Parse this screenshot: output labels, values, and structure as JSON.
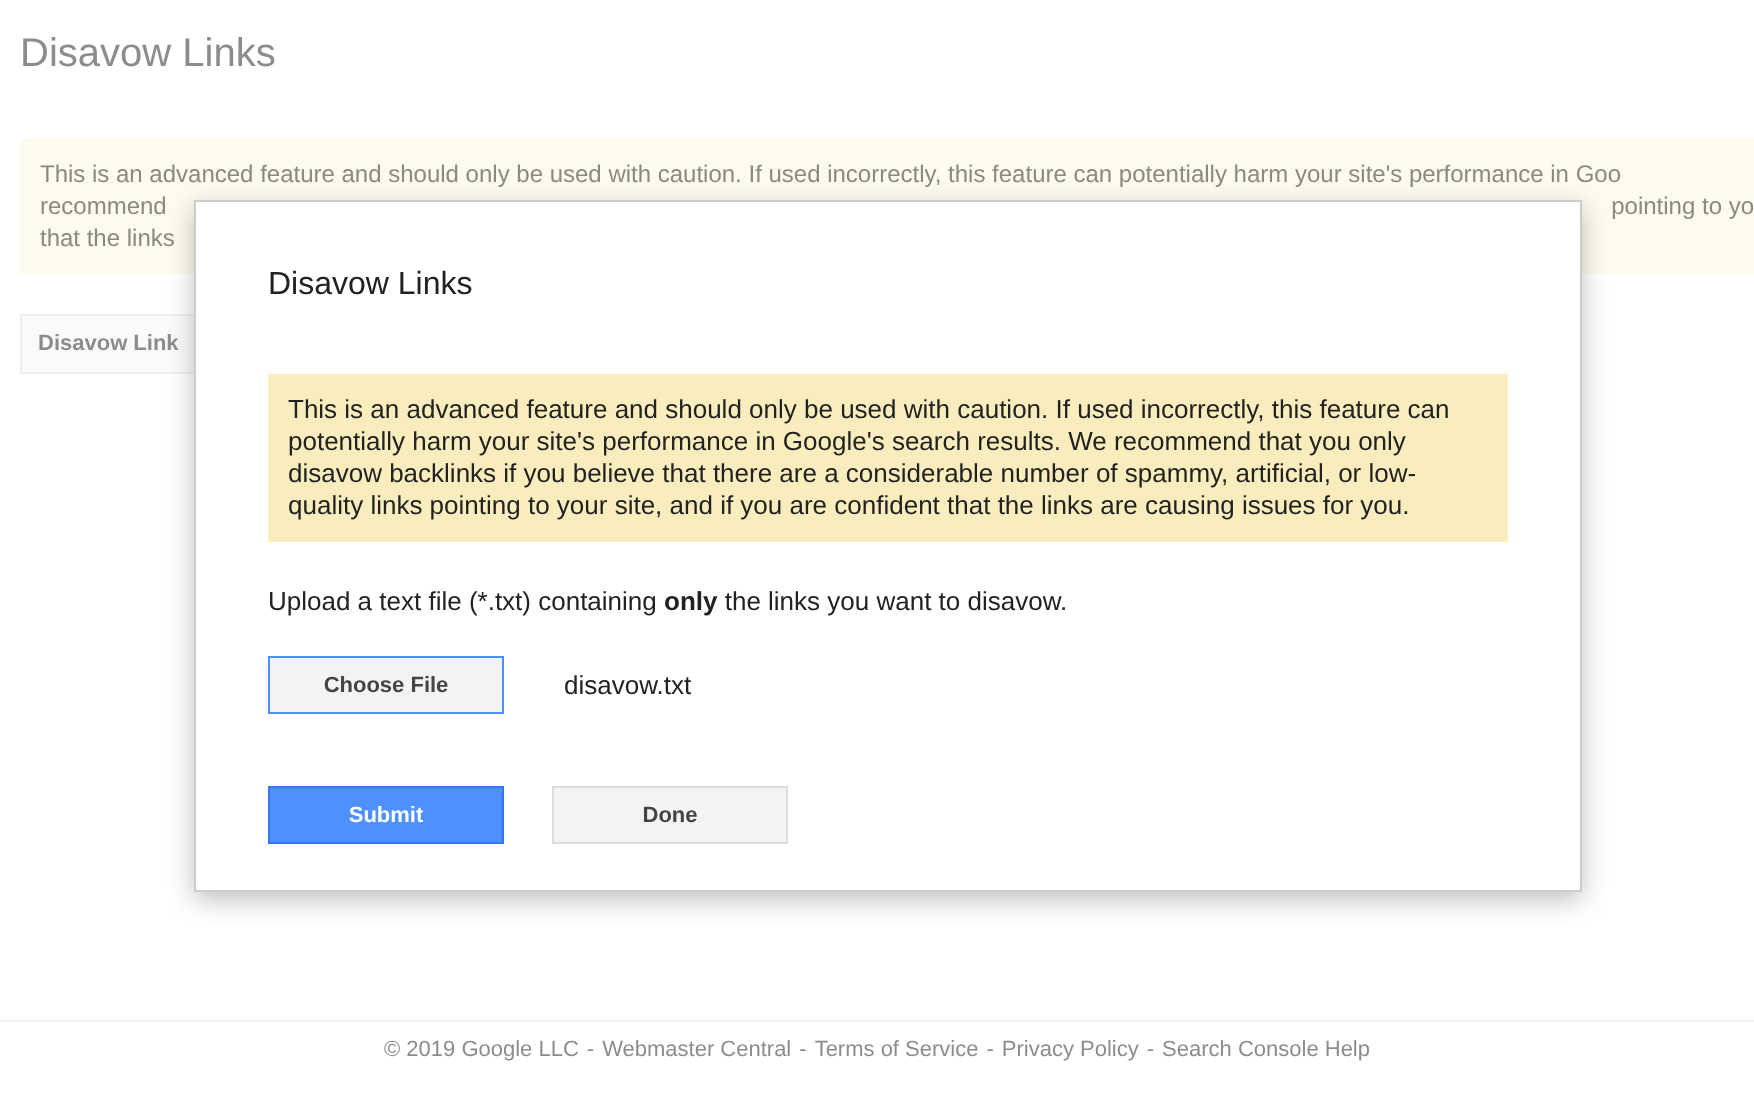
{
  "page": {
    "title": "Disavow Links",
    "banner_lines": [
      {
        "left": "This is an advanced feature and should only be used with caution. If used incorrectly, this feature can potentially harm your site's performance in Goo"
      },
      {
        "left": "recommend",
        "right": "pointing to yo"
      },
      {
        "left": "that the links"
      }
    ],
    "button": "Disavow Link"
  },
  "dialog": {
    "title": "Disavow Links",
    "warning": "This is an advanced feature and should only be used with caution. If used incorrectly, this feature can potentially harm your site's performance in Google's search results. We recommend that you only disavow backlinks if you believe that there are a considerable number of spammy, artificial, or low-quality links pointing to your site, and if you are confident that the links are causing issues for you.",
    "instruction": "Upload a text file (*.txt) containing **only** the links you want to disavow.",
    "choose_button": "Choose File",
    "file_name": "disavow.txt",
    "buttons": [
      {
        "label": "Submit",
        "kind": "primary"
      },
      {
        "label": "Done",
        "kind": "secondary"
      }
    ]
  },
  "footer": {
    "copyright": "© 2019 Google LLC",
    "links": [
      "Webmaster Central",
      "Terms of Service",
      "Privacy Policy",
      "Search Console Help"
    ],
    "separator": "-"
  }
}
